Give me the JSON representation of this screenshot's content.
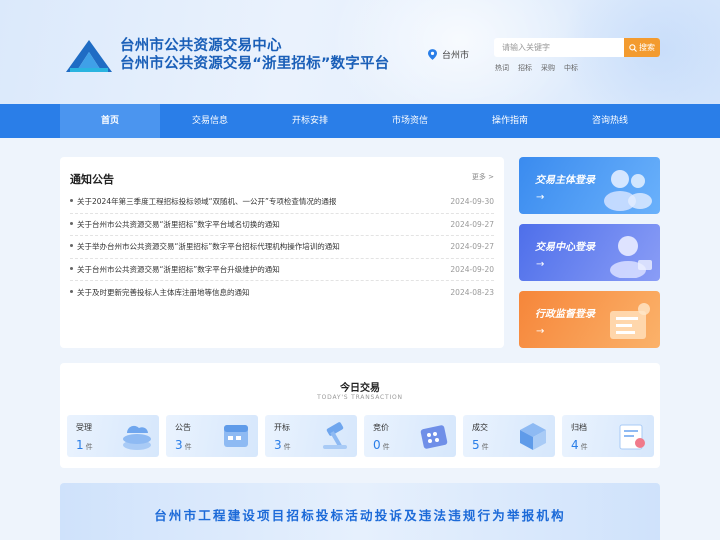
{
  "header": {
    "title_line1": "台州市公共资源交易中心",
    "title_line2": "台州市公共资源交易“浙里招标”数字平台",
    "location": "台州市",
    "search_placeholder": "请输入关键字",
    "search_button": "搜索",
    "hot_label": "热词",
    "hot_words": [
      "招标",
      "采购",
      "中标"
    ]
  },
  "nav": {
    "items": [
      "首页",
      "交易信息",
      "开标安排",
      "市场资信",
      "操作指南",
      "咨询热线"
    ],
    "active_index": 0
  },
  "notice": {
    "title": "通知公告",
    "more": "更多 >",
    "rows": [
      {
        "text": "关于2024年第三季度工程招标投标领域“双随机、一公开”专项检查情况的通报",
        "date": "2024-09-30"
      },
      {
        "text": "关于台州市公共资源交易“浙里招标”数字平台域名切换的通知",
        "date": "2024-09-27"
      },
      {
        "text": "关于举办台州市公共资源交易“浙里招标”数字平台招标代理机构操作培训的通知",
        "date": "2024-09-27"
      },
      {
        "text": "关于台州市公共资源交易“浙里招标”数字平台升级维护的通知",
        "date": "2024-09-20"
      },
      {
        "text": "关于及时更新完善投标人主体库注册地等信息的通知",
        "date": "2024-08-23"
      }
    ]
  },
  "login_cards": [
    {
      "label": "交易主体登录",
      "arrow": "→",
      "icon": "users-icon"
    },
    {
      "label": "交易中心登录",
      "arrow": "→",
      "icon": "user-icon"
    },
    {
      "label": "行政监督登录",
      "arrow": "→",
      "icon": "document-icon"
    }
  ],
  "today": {
    "title": "今日交易",
    "subtitle": "TODAY'S TRANSACTION",
    "unit": "件",
    "items": [
      {
        "label": "受理",
        "count": "1"
      },
      {
        "label": "公告",
        "count": "3"
      },
      {
        "label": "开标",
        "count": "3"
      },
      {
        "label": "竞价",
        "count": "0"
      },
      {
        "label": "成交",
        "count": "5"
      },
      {
        "label": "归档",
        "count": "4"
      }
    ]
  },
  "banner": {
    "text": "台州市工程建设项目招标投标活动投诉及违法违规行为举报机构"
  },
  "colors": {
    "primary": "#2a7ee8",
    "title_blue": "#1a5fb8",
    "search_orange": "#f39b2f",
    "card_orange": "#f6863a"
  }
}
